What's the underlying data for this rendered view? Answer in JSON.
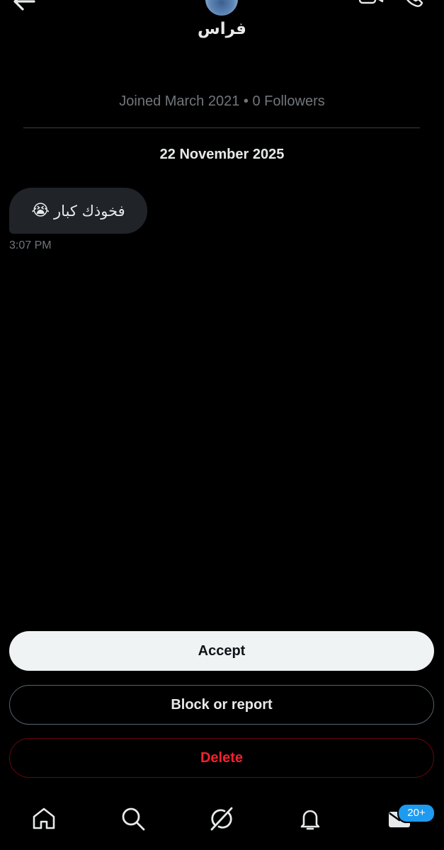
{
  "header": {
    "contact_name": "فراس",
    "back_icon": "arrow-left-icon",
    "video_icon": "video-camera-icon",
    "phone_icon": "phone-icon"
  },
  "profile": {
    "meta": "Joined March 2021 • 0 Followers"
  },
  "conversation": {
    "date_separator": "22 November 2025",
    "messages": [
      {
        "text": "فخوذك كبار",
        "emoji": "😭",
        "time": "3:07 PM"
      }
    ]
  },
  "actions": {
    "accept_label": "Accept",
    "block_label": "Block or report",
    "delete_label": "Delete"
  },
  "bottom_nav": {
    "items": [
      {
        "name": "home",
        "icon": "home-icon"
      },
      {
        "name": "search",
        "icon": "search-icon"
      },
      {
        "name": "grok",
        "icon": "grok-icon"
      },
      {
        "name": "notifications",
        "icon": "bell-icon"
      },
      {
        "name": "messages",
        "icon": "mail-icon"
      }
    ],
    "messages_badge": "20+"
  },
  "colors": {
    "background": "#000000",
    "bubble": "#202327",
    "secondary_text": "#71767b",
    "accept_bg": "#eff3f4",
    "danger": "#f4212e",
    "badge": "#1d9bf0"
  }
}
